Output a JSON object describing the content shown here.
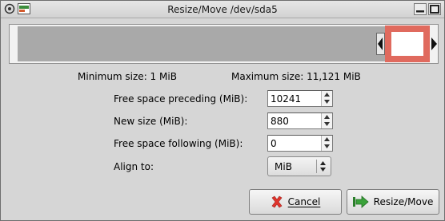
{
  "window": {
    "title": "Resize/Move /dev/sda5"
  },
  "icons": {
    "window_menu": "window-menu-icon",
    "app": "gparted-app-icon",
    "minimize": "minimize-icon",
    "maximize": "maximize-icon",
    "cancel": "cancel-x-icon",
    "resize": "resize-arrow-icon"
  },
  "colors": {
    "partition_border": "#e06a5e",
    "unallocated": "#a9a9a9",
    "cancel_icon": "#e0342c",
    "resize_icon": "#3aa23a"
  },
  "sizes": {
    "minimum": "Minimum size: 1 MiB",
    "maximum": "Maximum size: 11,121 MiB"
  },
  "fields": {
    "preceding": {
      "label": "Free space preceding (MiB):",
      "value": "10241"
    },
    "new_size": {
      "label": "New size (MiB):",
      "value": "880"
    },
    "following": {
      "label": "Free space following (MiB):",
      "value": "0"
    },
    "align": {
      "label": "Align to:",
      "value": "MiB"
    }
  },
  "buttons": {
    "cancel": "Cancel",
    "resize": "Resize/Move"
  }
}
